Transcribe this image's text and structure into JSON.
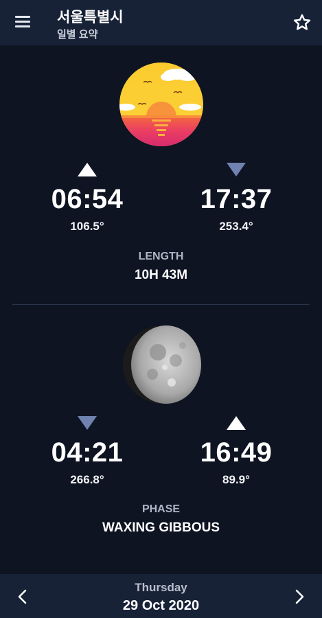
{
  "header": {
    "title": "서울특별시",
    "subtitle": "일별 요약",
    "menu_icon": "menu-icon",
    "star_icon": "star-outline-icon"
  },
  "sun": {
    "icon": "sunset-icon",
    "rise": {
      "time": "06:54",
      "azimuth": "106.5°",
      "icon": "triangle-up-icon"
    },
    "set": {
      "time": "17:37",
      "azimuth": "253.4°",
      "icon": "triangle-down-icon"
    },
    "length_label": "LENGTH",
    "length_value": "10H 43M"
  },
  "moon": {
    "icon": "moon-icon",
    "set": {
      "time": "04:21",
      "azimuth": "266.8°",
      "icon": "triangle-down-icon"
    },
    "rise": {
      "time": "16:49",
      "azimuth": "89.9°",
      "icon": "triangle-up-icon"
    },
    "phase_label": "PHASE",
    "phase_value": "WAXING GIBBOUS"
  },
  "footer": {
    "day": "Thursday",
    "date": "29 Oct 2020",
    "prev_icon": "chevron-left-icon",
    "next_icon": "chevron-right-icon"
  },
  "colors": {
    "background": "#0e1422",
    "bar": "#172237",
    "rise_triangle": "#ffffff",
    "set_triangle": "#6f82b0"
  }
}
